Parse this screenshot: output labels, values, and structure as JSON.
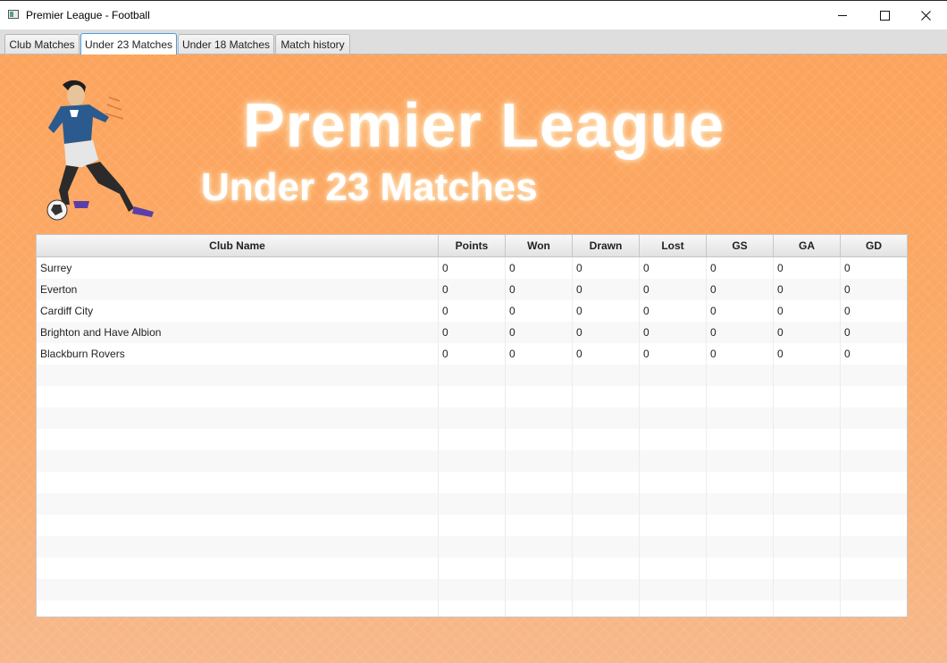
{
  "window": {
    "title": "Premier League - Football"
  },
  "tabs": [
    "Club Matches",
    "Under 23 Matches",
    "Under 18 Matches",
    "Match history"
  ],
  "active_tab": "Under 23 Matches",
  "header": {
    "title": "Premier League",
    "subtitle": "Under 23 Matches"
  },
  "table": {
    "columns": [
      "Club Name",
      "Points",
      "Won",
      "Drawn",
      "Lost",
      "GS",
      "GA",
      "GD"
    ],
    "rows": [
      [
        "Surrey",
        "0",
        "0",
        "0",
        "0",
        "0",
        "0",
        "0"
      ],
      [
        "Everton",
        "0",
        "0",
        "0",
        "0",
        "0",
        "0",
        "0"
      ],
      [
        "Cardiff City",
        "0",
        "0",
        "0",
        "0",
        "0",
        "0",
        "0"
      ],
      [
        "Brighton and Have Albion",
        "0",
        "0",
        "0",
        "0",
        "0",
        "0",
        "0"
      ],
      [
        "Blackburn Rovers",
        "0",
        "0",
        "0",
        "0",
        "0",
        "0",
        "0"
      ]
    ]
  },
  "colors": {
    "background_top": "#fca35c",
    "background_bottom": "#f7b88a",
    "active_tab_border": "#4a9be0"
  }
}
